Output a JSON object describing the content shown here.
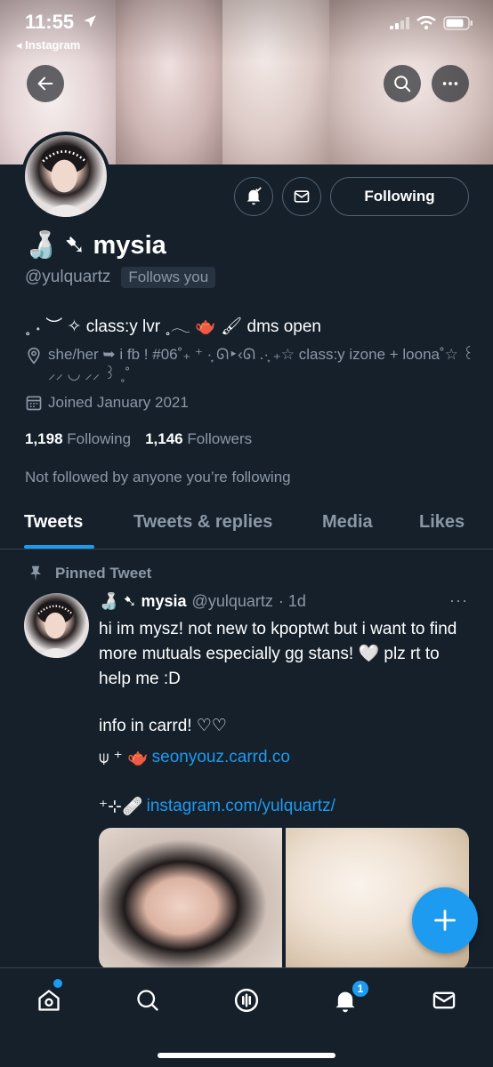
{
  "status_bar": {
    "time": "11:55",
    "back_app": "◂ Instagram"
  },
  "profile": {
    "display_name": "🍶 ➷ mysia",
    "handle": "@yulquartz",
    "follows_you": "Follows you",
    "following_button": "Following",
    "bio": "˳ ˖ ︶ ✧ class:y lvr ˳𓂃 🫖 🖌 dms open",
    "location": "she/her ➥ i fb ! #06˚₊ ⁺ ·͙ ᘏ‣‹ᘏ .·͙ ₊☆ class:y izone + loona˚☆ ꒰ ⸝⸝ ◡ ⸝⸝ ꒱ ˳˚",
    "joined": "Joined January 2021",
    "following_count": "1,198",
    "following_label": "Following",
    "followers_count": "1,146",
    "followers_label": "Followers",
    "not_followed": "Not followed by anyone you’re following"
  },
  "tabs": [
    "Tweets",
    "Tweets & replies",
    "Media",
    "Likes"
  ],
  "tweet": {
    "pinned_label": "Pinned Tweet",
    "name": "🍶 ➷ mysia",
    "handle": "@yulquartz",
    "time": "· 1d",
    "more": "···",
    "text": "hi im mysz! not new to kpoptwt but i want to find more mutuals especially gg stans! 🤍 plz rt to help me :D",
    "line2": "info in carrd! ♡♡",
    "link1_prefix": "⍦ ⁺ 🫖",
    "link1": "seonyouz.carrd.co",
    "link2_prefix": "⁺⊹🩹",
    "link2": "instagram.com/yulquartz/"
  },
  "nav": {
    "notif_badge": "1"
  },
  "colors": {
    "background": "#15202b",
    "accent": "#1d9bf0",
    "secondary_text": "#8b98a5",
    "border": "#38444d"
  }
}
